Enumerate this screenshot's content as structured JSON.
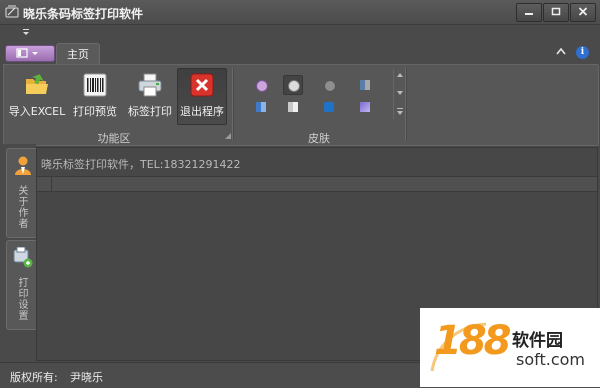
{
  "window": {
    "title": "晓乐条码标签打印软件",
    "controls": [
      "minimize-icon",
      "maximize-icon",
      "close-icon"
    ]
  },
  "ribbon": {
    "tabs": [
      {
        "label": "主页",
        "active": true
      }
    ],
    "groups": [
      {
        "label": "功能区",
        "buttons": [
          {
            "label": "导入EXCEL",
            "icon": "folder-import-icon"
          },
          {
            "label": "打印预览",
            "icon": "barcode-icon"
          },
          {
            "label": "标签打印",
            "icon": "printer-icon"
          },
          {
            "label": "退出程序",
            "icon": "exit-icon",
            "active": true
          }
        ]
      },
      {
        "label": "皮肤",
        "skins": [
          "skin-1",
          "skin-2",
          "skin-3",
          "skin-4",
          "skin-5",
          "skin-6",
          "skin-7",
          "skin-8"
        ]
      }
    ]
  },
  "side_panel": {
    "tabs": [
      {
        "label": "关于作者",
        "icon": "author-icon"
      },
      {
        "label": "打印设置",
        "icon": "print-settings-icon"
      }
    ]
  },
  "main": {
    "info_text": "晓乐标签打印软件，TEL:18321291422"
  },
  "status_bar": {
    "copyright_label": "版权所有:",
    "owner": "尹晓乐"
  },
  "watermark": {
    "number": "188",
    "name": "软件园",
    "site": "soft.com"
  },
  "colors": {
    "background": "#4a4a4a",
    "ribbon": "#575757",
    "app_menu": "#b48ac8",
    "watermark_orange": "#f39a1e"
  }
}
